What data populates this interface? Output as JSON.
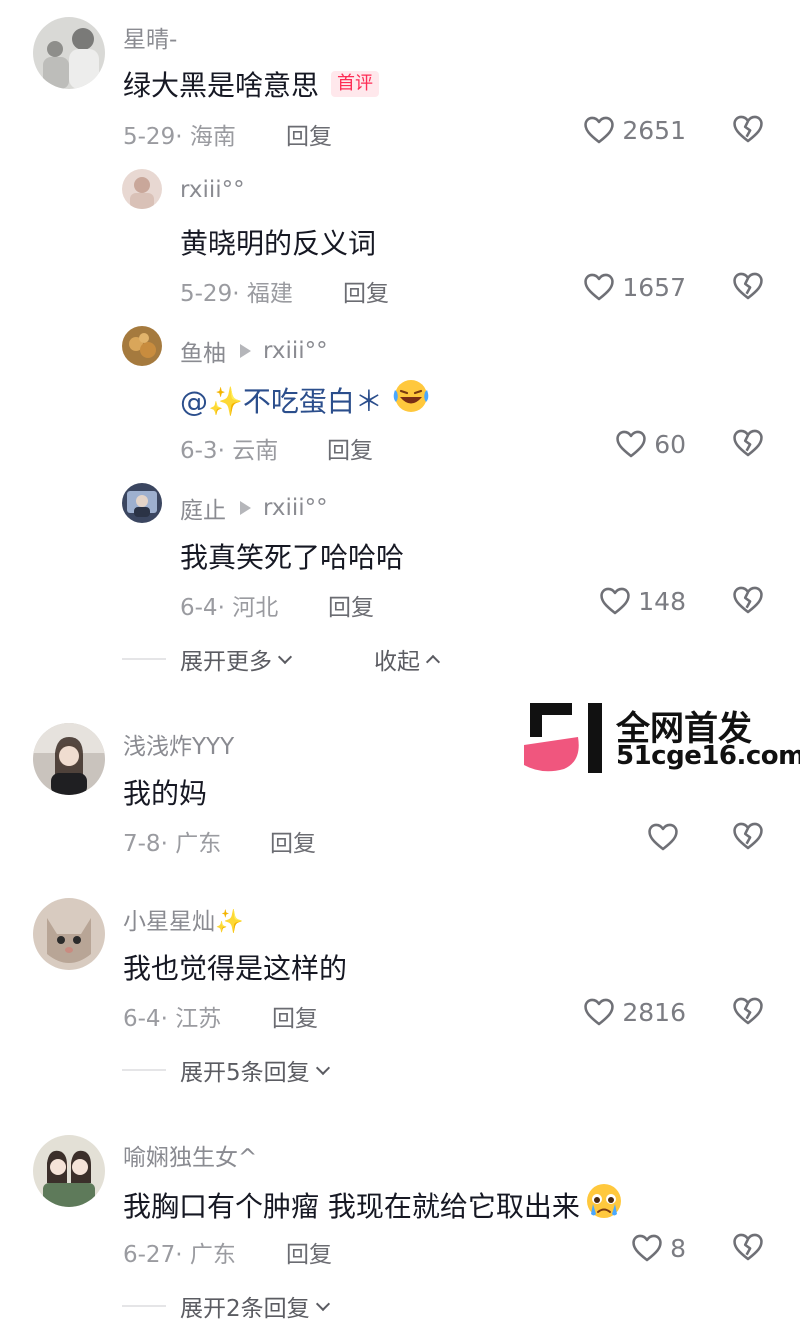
{
  "comments": [
    {
      "user": "星晴-",
      "text": "绿大黑是啥意思",
      "badge": "首评",
      "date": "5-29",
      "location": "海南",
      "reply_label": "回复",
      "likes": "2651",
      "replies": [
        {
          "user": "rxiii°°",
          "text": "黄晓明的反义词",
          "date": "5-29",
          "location": "福建",
          "reply_label": "回复",
          "likes": "1657"
        },
        {
          "user": "鱼柚",
          "reply_to": "rxiii°°",
          "mention": "@✨不吃蛋白＊",
          "date": "6-3",
          "location": "云南",
          "reply_label": "回复",
          "likes": "60"
        },
        {
          "user": "庭止",
          "reply_to": "rxiii°°",
          "text": "我真笑死了哈哈哈",
          "date": "6-4",
          "location": "河北",
          "reply_label": "回复",
          "likes": "148"
        }
      ],
      "expand_label": "展开更多",
      "collapse_label": "收起"
    },
    {
      "user": "浅浅炸YYY",
      "text": "我的妈",
      "date": "7-8",
      "location": "广东",
      "reply_label": "回复",
      "likes": ""
    },
    {
      "user": "小星星灿✨",
      "text": "我也觉得是这样的",
      "date": "6-4",
      "location": "江苏",
      "reply_label": "回复",
      "likes": "2816",
      "expand_label": "展开5条回复"
    },
    {
      "user": "喻娴独生女^",
      "text": "我胸口有个肿瘤 我现在就给它取出来",
      "date": "6-27",
      "location": "广东",
      "reply_label": "回复",
      "likes": "8",
      "expand_label": "展开2条回复"
    }
  ],
  "watermark": {
    "line1": "全网首发",
    "line2": "51cge16.com",
    "accent": "#f0567e"
  },
  "icons": {
    "like": "heart-outline-icon",
    "dislike": "broken-heart-icon",
    "laugh": "laughing-crying-emoji",
    "cry": "pleading-crying-emoji"
  }
}
